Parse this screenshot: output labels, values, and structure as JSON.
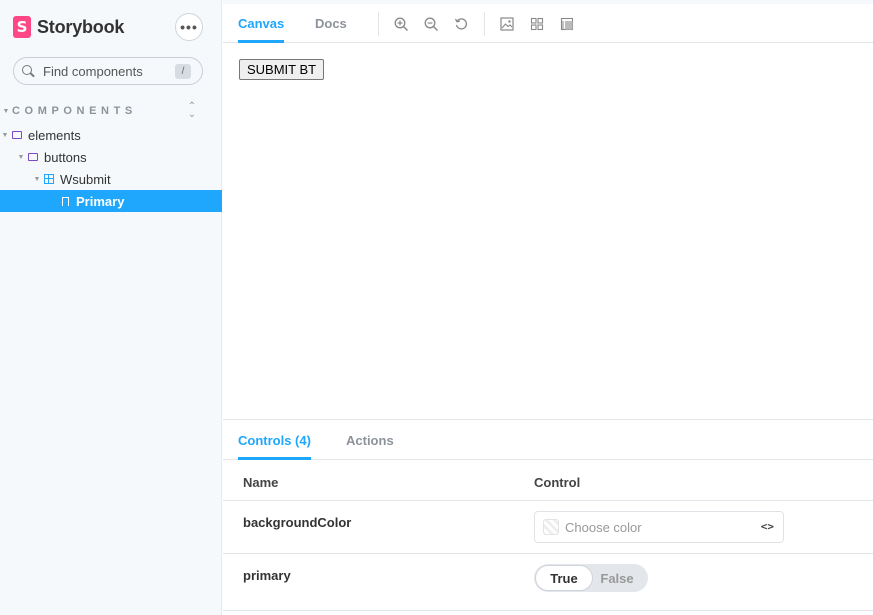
{
  "brand": {
    "logo_letter": "S",
    "name": "Storybook"
  },
  "sidebar": {
    "menu_label": "•••",
    "search": {
      "placeholder": "Find components",
      "shortcut": "/"
    },
    "section_title": "COMPONENTS",
    "tree": [
      {
        "label": "elements",
        "type": "folder",
        "depth": 0
      },
      {
        "label": "buttons",
        "type": "folder",
        "depth": 1
      },
      {
        "label": "Wsubmit",
        "type": "component",
        "depth": 2
      },
      {
        "label": "Primary",
        "type": "story",
        "depth": 3,
        "selected": true
      }
    ]
  },
  "toolbar": {
    "tabs": [
      {
        "label": "Canvas",
        "active": true
      },
      {
        "label": "Docs",
        "active": false
      }
    ],
    "icons": [
      "zoom-in-icon",
      "zoom-out-icon",
      "zoom-reset-icon",
      "background-icon",
      "grid-icon",
      "outline-icon"
    ]
  },
  "canvas": {
    "button_label": "SUBMIT BT"
  },
  "addons": {
    "tabs": [
      {
        "label": "Controls (4)",
        "active": true
      },
      {
        "label": "Actions",
        "active": false
      }
    ],
    "table": {
      "headers": {
        "name": "Name",
        "control": "Control"
      },
      "rows": [
        {
          "name": "backgroundColor",
          "control": "color",
          "placeholder": "Choose color"
        },
        {
          "name": "primary",
          "control": "boolean",
          "true_label": "True",
          "false_label": "False",
          "value": true
        }
      ]
    }
  },
  "colors": {
    "accent": "#1ea7fd",
    "brand": "#ff4785",
    "folder": "#7a4bc7"
  }
}
